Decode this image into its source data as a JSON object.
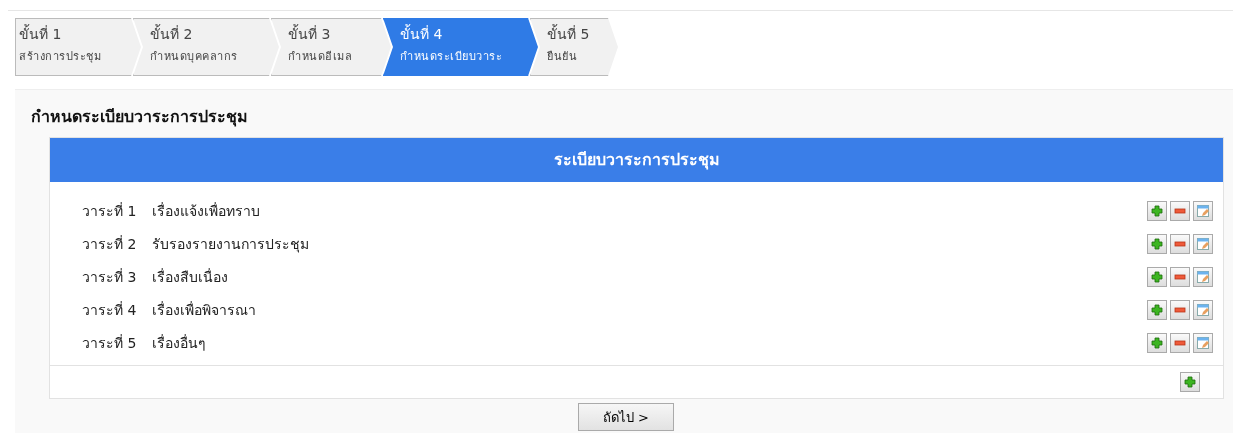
{
  "steps": [
    {
      "label": "ขั้นที่ 1",
      "caption": "สร้างการประชุม",
      "selected": false
    },
    {
      "label": "ขั้นที่ 2",
      "caption": "กำหนดบุคคลากร",
      "selected": false
    },
    {
      "label": "ขั้นที่ 3",
      "caption": "กำหนดอีเมล",
      "selected": false
    },
    {
      "label": "ขั้นที่ 4",
      "caption": "กำหนดระเบียบวาระ",
      "selected": true
    },
    {
      "label": "ขั้นที่ 5",
      "caption": "ยืนยัน",
      "selected": false
    }
  ],
  "section_title": "กำหนดระเบียบวาระการประชุม",
  "table": {
    "header": "ระเบียบวาระการประชุม",
    "rows": [
      {
        "number": "วาระที่ 1",
        "title": "เรื่องแจ้งเพื่อทราบ"
      },
      {
        "number": "วาระที่ 2",
        "title": "รับรองรายงานการประชุม"
      },
      {
        "number": "วาระที่ 3",
        "title": "เรื่องสืบเนื่อง"
      },
      {
        "number": "วาระที่ 4",
        "title": "เรื่องเพื่อพิจารณา"
      },
      {
        "number": "วาระที่ 5",
        "title": "เรื่องอื่นๆ"
      }
    ]
  },
  "next_button": "ถัดไป >"
}
